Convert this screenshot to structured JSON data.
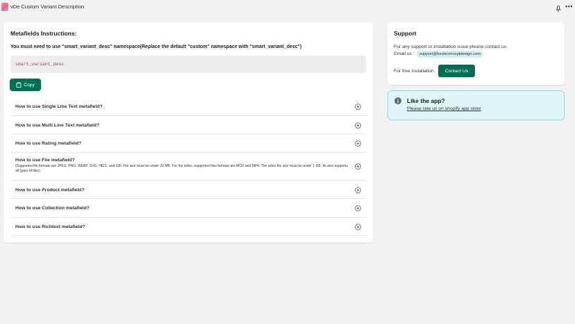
{
  "app": {
    "title": "vDe Custom Variant Description",
    "more_label": "•••"
  },
  "metafields": {
    "title": "Metafields Instructions:",
    "instruction": "You must need to use \"smart_variant_desc\" namespace(Replace the default \"custom\" namespace with \"smart_variant_desc\")",
    "namespace_code": "smart_variant_desc",
    "copy_label": "Copy",
    "faqs": [
      {
        "question": "How to use Single Line Text metafield?",
        "note": ""
      },
      {
        "question": "How to use Multi Line Text metafield?",
        "note": ""
      },
      {
        "question": "How to use Rating metafield?",
        "note": ""
      },
      {
        "question": "How to use File metafield?",
        "note": "(Supported file formats are JPEG, PNG, WEBP, SVG, HEIC, and GIF. File size must be under 20 MB. For the video, supported files formats are MOV and MP4. The video file size must be under 1 GB. Its also supports all types of files)"
      },
      {
        "question": "How to use Product metafield?",
        "note": ""
      },
      {
        "question": "How to use Collection metafield?",
        "note": ""
      },
      {
        "question": "How to use Richtext metafield?",
        "note": ""
      }
    ]
  },
  "support": {
    "title": "Support",
    "line1": "For any support or installation issue please contact us.",
    "email_label": "Email us :",
    "email": "support@freshconceptdesign.com",
    "free_install_label": "For free installation",
    "contact_button": "Contact Us"
  },
  "like": {
    "title": "Like the app?",
    "link": "Please rate us on shopify app store"
  },
  "colors": {
    "primary_button": "#006e52",
    "info_bg": "#e0f5f5",
    "code_text": "#c0305a"
  },
  "icons": {
    "app": "app-logo-icon",
    "pin": "pin-icon",
    "more": "more-icon",
    "copy": "clipboard-icon",
    "expand": "plus-circle-icon",
    "info": "info-icon"
  }
}
